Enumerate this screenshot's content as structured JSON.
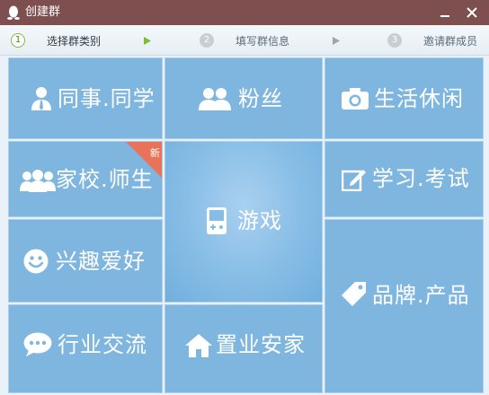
{
  "window": {
    "title": "创建群"
  },
  "steps": [
    {
      "number": "1",
      "label": "选择群类别"
    },
    {
      "number": "2",
      "label": "填写群信息"
    },
    {
      "number": "3",
      "label": "邀请群成员"
    }
  ],
  "categories": {
    "colleague": {
      "label": "同事.同学",
      "icon": "user-tie-icon"
    },
    "fans": {
      "label": "粉丝",
      "icon": "users-icon"
    },
    "leisure": {
      "label": "生活休闲",
      "icon": "camera-icon"
    },
    "school": {
      "label": "家校.师生",
      "icon": "group-icon",
      "badge": "新"
    },
    "game": {
      "label": "游戏",
      "icon": "gamepad-icon"
    },
    "study": {
      "label": "学习.考试",
      "icon": "edit-icon"
    },
    "hobby": {
      "label": "兴趣爱好",
      "icon": "smiley-icon"
    },
    "brand": {
      "label": "品牌.产品",
      "icon": "tag-icon"
    },
    "industry": {
      "label": "行业交流",
      "icon": "chat-bubble-icon"
    },
    "realestate": {
      "label": "置业安家",
      "icon": "home-icon"
    }
  },
  "colors": {
    "titlebar": "#7d4f4f",
    "tile": "#7fb6e0",
    "badge": "#e8735a",
    "step_active": "#7dbb3a"
  }
}
